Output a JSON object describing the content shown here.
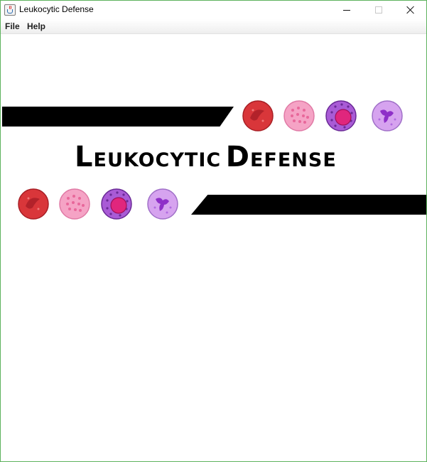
{
  "window": {
    "title": "Leukocytic Defense",
    "icon": "java-cup-icon",
    "controls": [
      "minimize-icon",
      "maximize-icon",
      "close-icon"
    ]
  },
  "menubar": {
    "items": [
      {
        "label": "File"
      },
      {
        "label": "Help"
      }
    ]
  },
  "banner": {
    "title_first_initial": "L",
    "title_first_rest": "EUKOCYTIC",
    "title_second_initial": "D",
    "title_second_rest": "EFENSE",
    "cells": [
      "neutrophil-cell-icon",
      "eosinophil-cell-icon",
      "basophil-cell-icon",
      "monocyte-cell-icon"
    ],
    "colors": {
      "bar": "#000000",
      "neutrophil": "#d9363a",
      "eosinophil": "#f28bb4",
      "basophil": "#a95bd6",
      "monocyte": "#c88ae6"
    }
  }
}
